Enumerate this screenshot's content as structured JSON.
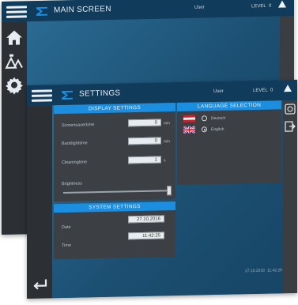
{
  "main_screen": {
    "title": "MAIN SCREEN",
    "user_label": "User",
    "level_label": "LEVEL",
    "level_value": "0",
    "sidebar_icons": [
      "home-icon",
      "machine-icon",
      "gear-icon"
    ]
  },
  "settings_screen": {
    "title": "SETTINGS",
    "user_label": "User",
    "level_label": "LEVEL",
    "level_value": "0",
    "display": {
      "header": "DISPLAY SETTINGS",
      "screensaver_label": "Screensavertime",
      "screensaver_value": "0",
      "screensaver_unit": "min",
      "backlight_label": "Backlighttime",
      "backlight_value": "0",
      "backlight_unit": "min",
      "cleaning_label": "Cleaningtime",
      "cleaning_value": "1",
      "cleaning_unit": "s",
      "brightness_label": "Brightness",
      "brightness_level": 1.0
    },
    "system": {
      "header": "SYSTEM SETTINGS",
      "date_label": "Date",
      "date_value": "27.10.2016",
      "time_label": "Time",
      "time_value": "11:42:25"
    },
    "language": {
      "header": "LANGUAGE SELECTION",
      "options": [
        {
          "label": "Deutsch",
          "flag": "austria-flag-icon",
          "selected": false
        },
        {
          "label": "English",
          "flag": "uk-flag-icon",
          "selected": true
        }
      ]
    },
    "status_date": "27.10.2016",
    "status_time": "11:42:25",
    "right_icons": [
      "screen-settings-icon",
      "export-icon"
    ],
    "back_icon": "back-arrow-icon"
  },
  "colors": {
    "accent": "#1c8ee0",
    "topbar": "#103b5a",
    "background": "#1e5c80",
    "panel": "#3c4045"
  }
}
